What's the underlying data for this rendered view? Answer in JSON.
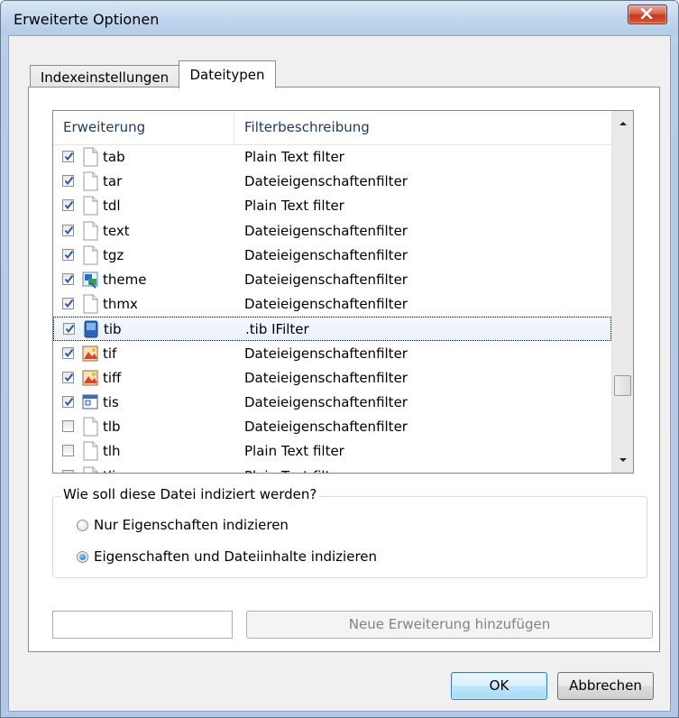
{
  "window": {
    "title": "Erweiterte Optionen"
  },
  "tabs": [
    {
      "label": "Indexeinstellungen",
      "active": false
    },
    {
      "label": "Dateitypen",
      "active": true
    }
  ],
  "list": {
    "columns": [
      "Erweiterung",
      "Filterbeschreibung"
    ],
    "rows": [
      {
        "ext": "tab",
        "filter": "Plain Text filter",
        "checked": true,
        "icon": "blank-file-icon"
      },
      {
        "ext": "tar",
        "filter": "Dateieigenschaftenfilter",
        "checked": true,
        "icon": "blank-file-icon"
      },
      {
        "ext": "tdl",
        "filter": "Plain Text filter",
        "checked": true,
        "icon": "blank-file-icon"
      },
      {
        "ext": "text",
        "filter": "Dateieigenschaftenfilter",
        "checked": true,
        "icon": "blank-file-icon"
      },
      {
        "ext": "tgz",
        "filter": "Dateieigenschaftenfilter",
        "checked": true,
        "icon": "blank-file-icon"
      },
      {
        "ext": "theme",
        "filter": "Dateieigenschaftenfilter",
        "checked": true,
        "icon": "theme-file-icon"
      },
      {
        "ext": "thmx",
        "filter": "Dateieigenschaftenfilter",
        "checked": true,
        "icon": "blank-file-icon"
      },
      {
        "ext": "tib",
        "filter": ".tib IFilter",
        "checked": true,
        "icon": "tib-file-icon",
        "selected": true
      },
      {
        "ext": "tif",
        "filter": "Dateieigenschaftenfilter",
        "checked": true,
        "icon": "image-file-icon"
      },
      {
        "ext": "tiff",
        "filter": "Dateieigenschaftenfilter",
        "checked": true,
        "icon": "image-file-icon"
      },
      {
        "ext": "tis",
        "filter": "Dateieigenschaftenfilter",
        "checked": true,
        "icon": "window-file-icon"
      },
      {
        "ext": "tlb",
        "filter": "Dateieigenschaftenfilter",
        "checked": false,
        "icon": "blank-file-icon"
      },
      {
        "ext": "tlh",
        "filter": "Plain Text filter",
        "checked": false,
        "icon": "blank-file-icon"
      },
      {
        "ext": "tli",
        "filter": "Plain Text filter",
        "checked": false,
        "icon": "blank-file-icon"
      }
    ]
  },
  "index_group": {
    "label": "Wie soll diese Datei indiziert werden?",
    "options": [
      {
        "label": "Nur Eigenschaften indizieren",
        "selected": false
      },
      {
        "label": "Eigenschaften und Dateiinhalte indizieren",
        "selected": true
      }
    ]
  },
  "new_extension": {
    "input_value": "",
    "button_label": "Neue Erweiterung hinzufügen"
  },
  "buttons": {
    "ok": "OK",
    "cancel": "Abbrechen"
  },
  "colors": {
    "selected_row": "#e8f0fa",
    "title_bar": "#c2d7ef",
    "close_button": "#c2391f"
  }
}
